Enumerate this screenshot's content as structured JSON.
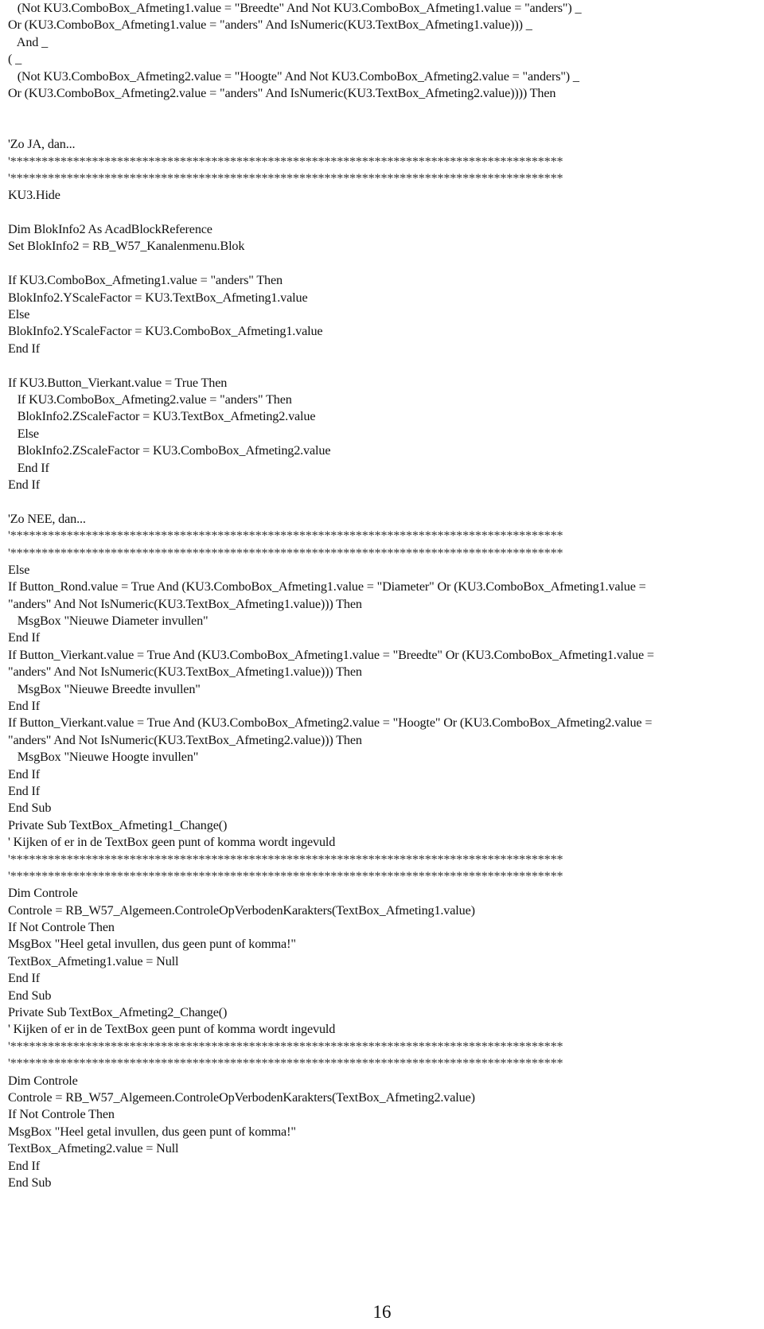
{
  "document": {
    "lines": [
      {
        "text": "   (Not KU3.ComboBox_Afmeting1.value = \"Breedte\" And Not KU3.ComboBox_Afmeting1.value = \"anders\") _",
        "type": "code"
      },
      {
        "text": "Or (KU3.ComboBox_Afmeting1.value = \"anders\" And IsNumeric(KU3.TextBox_Afmeting1.value))) _",
        "type": "code"
      },
      {
        "text": "   And _",
        "type": "code"
      },
      {
        "text": "( _",
        "type": "code"
      },
      {
        "text": "   (Not KU3.ComboBox_Afmeting2.value = \"Hoogte\" And Not KU3.ComboBox_Afmeting2.value = \"anders\") _",
        "type": "code"
      },
      {
        "text": "Or (KU3.ComboBox_Afmeting2.value = \"anders\" And IsNumeric(KU3.TextBox_Afmeting2.value)))) Then",
        "type": "code"
      },
      {
        "text": "",
        "type": "blank"
      },
      {
        "text": "",
        "type": "blank"
      },
      {
        "text": "'Zo JA, dan...",
        "type": "comment"
      },
      {
        "text": "'****************************************************************************************",
        "type": "stars"
      },
      {
        "text": "'****************************************************************************************",
        "type": "stars"
      },
      {
        "text": "KU3.Hide",
        "type": "code"
      },
      {
        "text": "",
        "type": "blank"
      },
      {
        "text": "Dim BlokInfo2 As AcadBlockReference",
        "type": "code"
      },
      {
        "text": "Set BlokInfo2 = RB_W57_Kanalenmenu.Blok",
        "type": "code"
      },
      {
        "text": "",
        "type": "blank"
      },
      {
        "text": "If KU3.ComboBox_Afmeting1.value = \"anders\" Then",
        "type": "code"
      },
      {
        "text": "BlokInfo2.YScaleFactor = KU3.TextBox_Afmeting1.value",
        "type": "code"
      },
      {
        "text": "Else",
        "type": "code"
      },
      {
        "text": "BlokInfo2.YScaleFactor = KU3.ComboBox_Afmeting1.value",
        "type": "code"
      },
      {
        "text": "End If",
        "type": "code"
      },
      {
        "text": "",
        "type": "blank"
      },
      {
        "text": "If KU3.Button_Vierkant.value = True Then",
        "type": "code"
      },
      {
        "text": "   If KU3.ComboBox_Afmeting2.value = \"anders\" Then",
        "type": "code"
      },
      {
        "text": "   BlokInfo2.ZScaleFactor = KU3.TextBox_Afmeting2.value",
        "type": "code"
      },
      {
        "text": "   Else",
        "type": "code"
      },
      {
        "text": "   BlokInfo2.ZScaleFactor = KU3.ComboBox_Afmeting2.value",
        "type": "code"
      },
      {
        "text": "   End If",
        "type": "code"
      },
      {
        "text": "End If",
        "type": "code"
      },
      {
        "text": "",
        "type": "blank"
      },
      {
        "text": "'Zo NEE, dan...",
        "type": "comment"
      },
      {
        "text": "'****************************************************************************************",
        "type": "stars"
      },
      {
        "text": "'****************************************************************************************",
        "type": "stars"
      },
      {
        "text": "Else",
        "type": "code"
      },
      {
        "text": "If Button_Rond.value = True And (KU3.ComboBox_Afmeting1.value = \"Diameter\" Or (KU3.ComboBox_Afmeting1.value =",
        "type": "code"
      },
      {
        "text": "\"anders\" And Not IsNumeric(KU3.TextBox_Afmeting1.value))) Then",
        "type": "code"
      },
      {
        "text": "   MsgBox \"Nieuwe Diameter invullen\"",
        "type": "code"
      },
      {
        "text": "End If",
        "type": "code"
      },
      {
        "text": "If Button_Vierkant.value = True And (KU3.ComboBox_Afmeting1.value = \"Breedte\" Or (KU3.ComboBox_Afmeting1.value =",
        "type": "code"
      },
      {
        "text": "\"anders\" And Not IsNumeric(KU3.TextBox_Afmeting1.value))) Then",
        "type": "code"
      },
      {
        "text": "   MsgBox \"Nieuwe Breedte invullen\"",
        "type": "code"
      },
      {
        "text": "End If",
        "type": "code"
      },
      {
        "text": "If Button_Vierkant.value = True And (KU3.ComboBox_Afmeting2.value = \"Hoogte\" Or (KU3.ComboBox_Afmeting2.value =",
        "type": "code"
      },
      {
        "text": "\"anders\" And Not IsNumeric(KU3.TextBox_Afmeting2.value))) Then",
        "type": "code"
      },
      {
        "text": "   MsgBox \"Nieuwe Hoogte invullen\"",
        "type": "code"
      },
      {
        "text": "End If",
        "type": "code"
      },
      {
        "text": "End If",
        "type": "code"
      },
      {
        "text": "End Sub",
        "type": "code"
      },
      {
        "text": "Private Sub TextBox_Afmeting1_Change()",
        "type": "code"
      },
      {
        "text": "' Kijken of er in de TextBox geen punt of komma wordt ingevuld",
        "type": "comment"
      },
      {
        "text": "'****************************************************************************************",
        "type": "stars"
      },
      {
        "text": "'****************************************************************************************",
        "type": "stars"
      },
      {
        "text": "Dim Controle",
        "type": "code"
      },
      {
        "text": "Controle = RB_W57_Algemeen.ControleOpVerbodenKarakters(TextBox_Afmeting1.value)",
        "type": "code"
      },
      {
        "text": "If Not Controle Then",
        "type": "code"
      },
      {
        "text": "MsgBox \"Heel getal invullen, dus geen punt of komma!\"",
        "type": "code"
      },
      {
        "text": "TextBox_Afmeting1.value = Null",
        "type": "code"
      },
      {
        "text": "End If",
        "type": "code"
      },
      {
        "text": "End Sub",
        "type": "code"
      },
      {
        "text": "Private Sub TextBox_Afmeting2_Change()",
        "type": "code"
      },
      {
        "text": "' Kijken of er in de TextBox geen punt of komma wordt ingevuld",
        "type": "comment"
      },
      {
        "text": "'****************************************************************************************",
        "type": "stars"
      },
      {
        "text": "'****************************************************************************************",
        "type": "stars"
      },
      {
        "text": "Dim Controle",
        "type": "code"
      },
      {
        "text": "Controle = RB_W57_Algemeen.ControleOpVerbodenKarakters(TextBox_Afmeting2.value)",
        "type": "code"
      },
      {
        "text": "If Not Controle Then",
        "type": "code"
      },
      {
        "text": "MsgBox \"Heel getal invullen, dus geen punt of komma!\"",
        "type": "code"
      },
      {
        "text": "TextBox_Afmeting2.value = Null",
        "type": "code"
      },
      {
        "text": "End If",
        "type": "code"
      },
      {
        "text": "End Sub",
        "type": "code"
      }
    ]
  },
  "footer": {
    "page_number": "16"
  }
}
